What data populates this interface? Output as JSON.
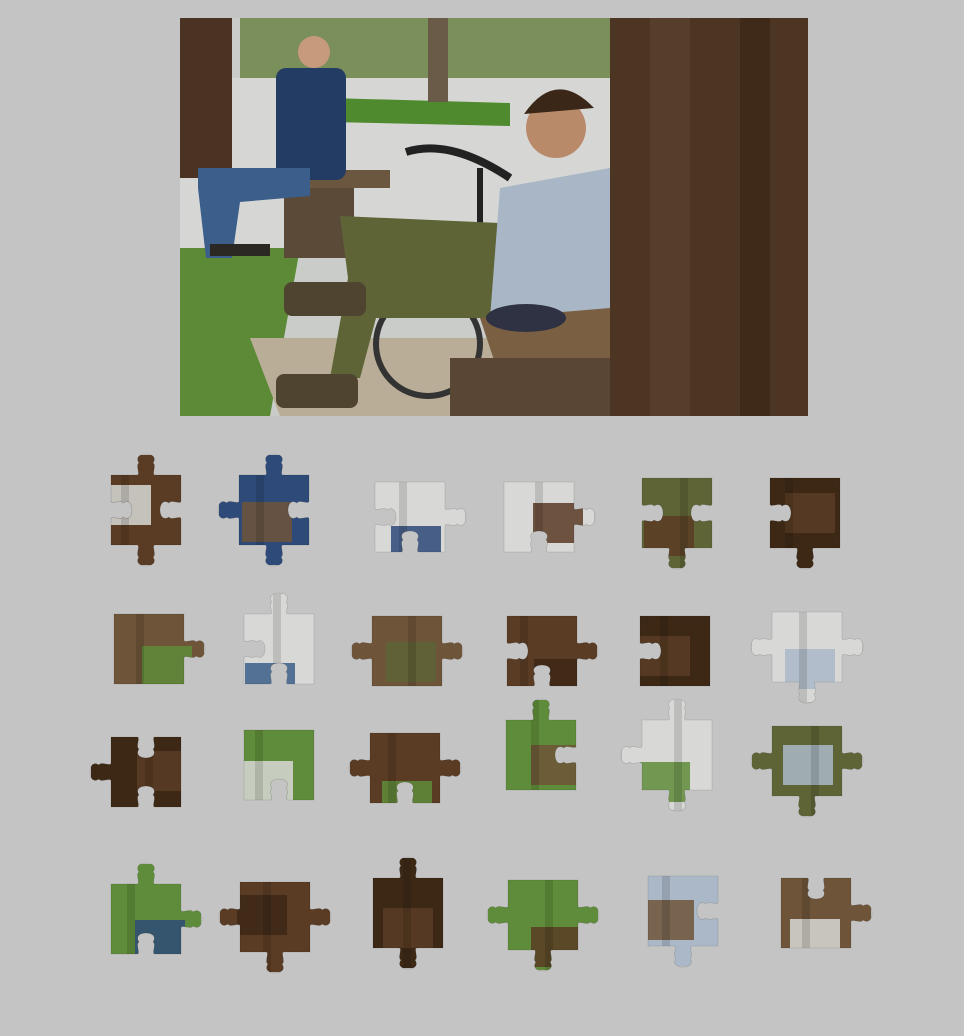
{
  "puzzle": {
    "rows": 4,
    "cols": 6,
    "piece_count": 24,
    "colors": {
      "background": "#c4c4c4",
      "bark": "#5a3c24",
      "bark_dark": "#3d2816",
      "grass": "#5f8c3a",
      "path": "#d8d8d6",
      "denim": "#2e4a78",
      "jeans": "#3b5f8a",
      "shirt": "#aab8c8",
      "khaki": "#5e6436",
      "bench": "#6e5438"
    },
    "pieces": [
      {
        "id": "p1",
        "fill": "bark",
        "accent": "path"
      },
      {
        "id": "p2",
        "fill": "denim",
        "accent": "bench"
      },
      {
        "id": "p3",
        "fill": "path",
        "accent": "denim"
      },
      {
        "id": "p4",
        "fill": "path",
        "accent": "bark"
      },
      {
        "id": "p5",
        "fill": "khaki",
        "accent": "bark"
      },
      {
        "id": "p6",
        "fill": "bark_dark",
        "accent": "bark"
      },
      {
        "id": "p7",
        "fill": "bench",
        "accent": "grass"
      },
      {
        "id": "p8",
        "fill": "path",
        "accent": "jeans"
      },
      {
        "id": "p9",
        "fill": "bench",
        "accent": "khaki"
      },
      {
        "id": "p10",
        "fill": "bark",
        "accent": "bark_dark"
      },
      {
        "id": "p11",
        "fill": "bark_dark",
        "accent": "bark"
      },
      {
        "id": "p12",
        "fill": "path",
        "accent": "shirt"
      },
      {
        "id": "p13",
        "fill": "bark_dark",
        "accent": "bark"
      },
      {
        "id": "p14",
        "fill": "grass",
        "accent": "path"
      },
      {
        "id": "p15",
        "fill": "bark",
        "accent": "grass"
      },
      {
        "id": "p16",
        "fill": "grass",
        "accent": "bench"
      },
      {
        "id": "p17",
        "fill": "path",
        "accent": "grass"
      },
      {
        "id": "p18",
        "fill": "khaki",
        "accent": "shirt"
      },
      {
        "id": "p19",
        "fill": "grass",
        "accent": "denim"
      },
      {
        "id": "p20",
        "fill": "bark",
        "accent": "bark_dark"
      },
      {
        "id": "p21",
        "fill": "bark_dark",
        "accent": "bark"
      },
      {
        "id": "p22",
        "fill": "grass",
        "accent": "bark"
      },
      {
        "id": "p23",
        "fill": "shirt",
        "accent": "bench"
      },
      {
        "id": "p24",
        "fill": "bench",
        "accent": "path"
      }
    ]
  }
}
